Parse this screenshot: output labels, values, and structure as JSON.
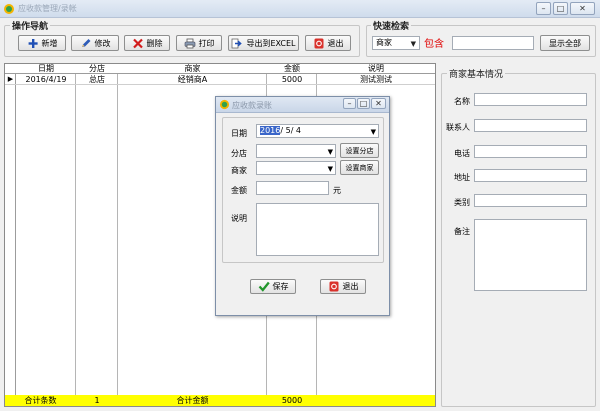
{
  "window": {
    "title": "应收款管理/录帐",
    "min_label": "–",
    "max_label": "□",
    "close_label": "✕"
  },
  "toolbar": {
    "group_title": "操作导航",
    "buttons": [
      {
        "label": "新增"
      },
      {
        "label": "修改"
      },
      {
        "label": "删除"
      },
      {
        "label": "打印"
      },
      {
        "label": "导出到EXCEL"
      },
      {
        "label": "退出"
      }
    ]
  },
  "quick_search": {
    "group_title": "快速检索",
    "field_value": "商家",
    "operator": "包含",
    "keyword_value": "",
    "show_all_label": "显示全部"
  },
  "grid": {
    "columns": [
      "日期",
      "分店",
      "商家",
      "金额",
      "说明"
    ],
    "rows": [
      {
        "marker": "▶",
        "date": "2016/4/19",
        "branch": "总店",
        "merchant": "经销商A",
        "amount": "5000",
        "note": "测试测试"
      }
    ],
    "footer": {
      "count_label": "合计条数",
      "count_value": "1",
      "amount_label": "合计金额",
      "amount_value": "5000"
    }
  },
  "merchant_info": {
    "title": "商家基本情况",
    "fields": [
      {
        "label": "名称",
        "value": ""
      },
      {
        "label": "联系人",
        "value": ""
      },
      {
        "label": "电话",
        "value": ""
      },
      {
        "label": "地址",
        "value": ""
      },
      {
        "label": "类别",
        "value": ""
      },
      {
        "label": "备注",
        "value": ""
      }
    ]
  },
  "dialog": {
    "title": "应收款录账",
    "date_label": "日期",
    "date_year": "2016",
    "date_rest": "/ 5/ 4",
    "branch_label": "分店",
    "branch_value": "",
    "set_branch_label": "设置分店",
    "merchant_label": "商家",
    "merchant_value": "",
    "set_merchant_label": "设置商家",
    "amount_label": "金额",
    "amount_value": "",
    "amount_unit": "元",
    "note_label": "说明",
    "note_value": "",
    "save_label": "保存",
    "exit_label": "退出",
    "min_label": "–",
    "max_label": "□",
    "close_label": "✕"
  },
  "colors": {
    "footer_highlight": "#ffff00",
    "operator_text": "#e00000",
    "selection": "#3a66c9"
  }
}
